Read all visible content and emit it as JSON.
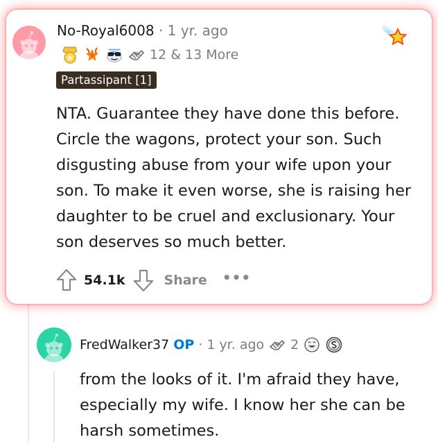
{
  "comment": {
    "username": "No-Royal6008",
    "separator": "·",
    "time": "1 yr. ago",
    "award_count": "12",
    "more_awards": "& 13 More",
    "flair": "Partassipant [1]",
    "body": "NTA. Guarantee they have done this before. Circle the wagons, protect your son. Such disgusting abuse from your wife upon your son. To make it even worse, she is raising her daughter to be cruel and exclusionary. Your son deserves so much better.",
    "score": "54.1k",
    "share_label": "Share",
    "more_label": "•••",
    "awards": [
      "medal-award-icon",
      "fire-star-award-icon",
      "sunglasses-award-icon",
      "helping-hand-award-icon",
      "star-award-icon"
    ],
    "colors": {
      "highlight": "#ff6b6b",
      "flair_bg": "#3a2e22",
      "avatar_bg": "#ff9aa8"
    }
  },
  "reply": {
    "username": "FredWalker37",
    "op_badge": "OP",
    "separator": "·",
    "time": "1 yr. ago",
    "award_count": "2",
    "body": "from the looks of it. I'm afraid they have, especially my wife. I know her she can be harsh sometimes.",
    "awards": [
      "helping-hand-award-icon",
      "laughing-award-icon",
      "silver-award-icon"
    ],
    "colors": {
      "op": "#0079d3",
      "avatar_bg": "#2bd3a5"
    }
  }
}
